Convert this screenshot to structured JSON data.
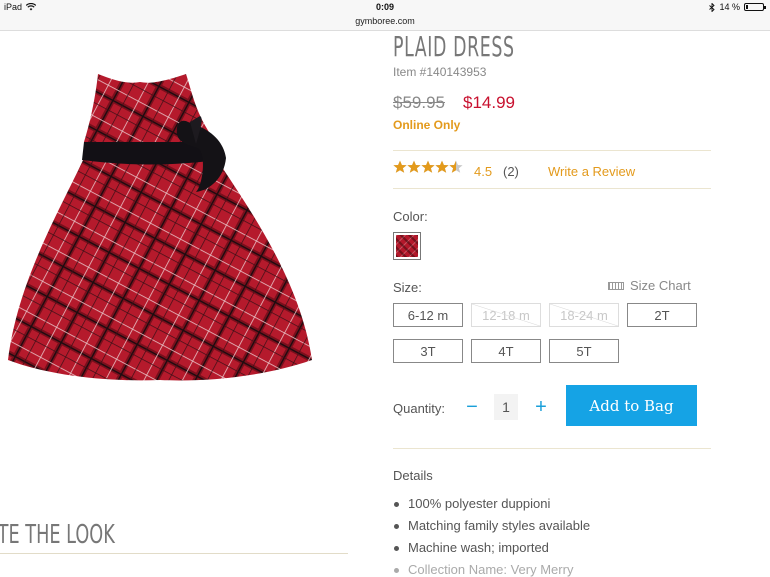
{
  "status_bar": {
    "device": "iPad",
    "time": "0:09",
    "battery_text": "14 %",
    "battery_level": 0.14,
    "icons": [
      "wifi-icon",
      "bluetooth-icon",
      "battery-icon"
    ]
  },
  "browser": {
    "url": "gymboree.com"
  },
  "product": {
    "title": "PLAID DRESS",
    "item_number": "Item #140143953",
    "price_original": "$59.95",
    "price_sale": "$14.99",
    "availability": "Online Only",
    "rating_value": "4.5",
    "rating_stars": 4.5,
    "rating_count": "(2)",
    "write_review": "Write a Review"
  },
  "color": {
    "label": "Color:",
    "swatch_color": "#b3182b"
  },
  "size": {
    "label": "Size:",
    "size_chart": "Size Chart",
    "options": [
      {
        "label": "6-12 m",
        "available": true
      },
      {
        "label": "12-18 m",
        "available": false
      },
      {
        "label": "18-24 m",
        "available": false
      },
      {
        "label": "2T",
        "available": true
      },
      {
        "label": "3T",
        "available": true
      },
      {
        "label": "4T",
        "available": true
      },
      {
        "label": "5T",
        "available": true
      }
    ]
  },
  "quantity": {
    "label": "Quantity:",
    "minus": "−",
    "value": "1",
    "plus": "+"
  },
  "cta": {
    "add_to_bag": "Add to Bag",
    "color": "#15a3e5"
  },
  "details": {
    "title": "Details",
    "items": [
      "100% polyester duppioni",
      "Matching family styles available",
      "Machine wash; imported",
      "Collection Name: Very Merry"
    ]
  },
  "complete_look": {
    "heading": "PLETE THE LOOK"
  },
  "colors": {
    "accent_orange": "#e39a1c",
    "sale_red": "#c8102e",
    "link_blue": "#1a9fd9"
  }
}
